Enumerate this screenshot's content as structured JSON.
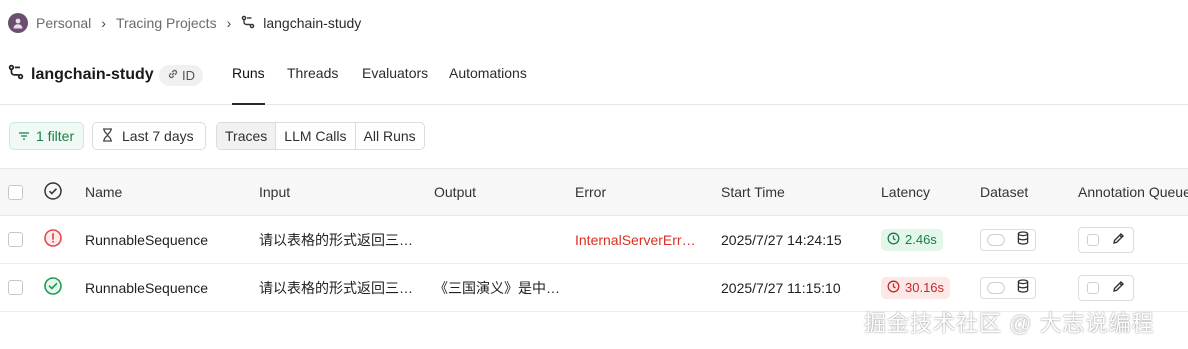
{
  "breadcrumb": {
    "workspace": "Personal",
    "section": "Tracing Projects",
    "project": "langchain-study"
  },
  "header": {
    "project_title": "langchain-study",
    "id_badge": "ID",
    "tabs": [
      {
        "label": "Runs",
        "active": true
      },
      {
        "label": "Threads",
        "active": false
      },
      {
        "label": "Evaluators",
        "active": false
      },
      {
        "label": "Automations",
        "active": false
      }
    ]
  },
  "toolbar": {
    "filter_label": "1 filter",
    "time_range_label": "Last 7 days",
    "view_modes": [
      {
        "label": "Traces",
        "selected": true
      },
      {
        "label": "LLM Calls",
        "selected": false
      },
      {
        "label": "All Runs",
        "selected": false
      }
    ]
  },
  "table": {
    "columns": [
      "Name",
      "Input",
      "Output",
      "Error",
      "Start Time",
      "Latency",
      "Dataset",
      "Annotation Queue"
    ],
    "rows": [
      {
        "status": "error",
        "name": "RunnableSequence",
        "input": "请以表格的形式返回三…",
        "output": "",
        "error": "InternalServerErr…",
        "start_time": "2025/7/27 14:24:15",
        "latency": "2.46s",
        "latency_level": "good"
      },
      {
        "status": "success",
        "name": "RunnableSequence",
        "input": "请以表格的形式返回三…",
        "output": "《三国演义》是中…",
        "error": "",
        "start_time": "2025/7/27 11:15:10",
        "latency": "30.16s",
        "latency_level": "bad"
      }
    ]
  },
  "watermark": "掘金技术社区 @ 大志说编程",
  "colors": {
    "success": "#1e9e55",
    "error": "#e5484d",
    "accent": "#1e7c4a"
  }
}
